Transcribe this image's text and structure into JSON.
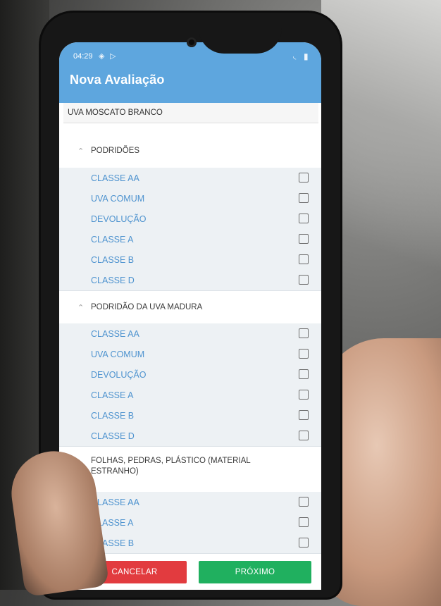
{
  "status_bar": {
    "time": "04:29",
    "left_icons": [
      "notification-icon",
      "play-store-icon"
    ],
    "right_icons": [
      "wifi-icon",
      "battery-icon"
    ]
  },
  "app_bar": {
    "title": "Nova Avaliação"
  },
  "variety": "UVA MOSCATO BRANCO",
  "colors": {
    "primary": "#5ea6de",
    "row_text": "#4e93cf",
    "cancel": "#e23b3f",
    "next": "#20b05f"
  },
  "groups": [
    {
      "title": "PODRIDÕES",
      "items": [
        "CLASSE AA",
        "UVA COMUM",
        "DEVOLUÇÃO",
        "CLASSE A",
        "CLASSE B",
        "CLASSE D"
      ]
    },
    {
      "title": "PODRIDÃO DA UVA MADURA",
      "items": [
        "CLASSE AA",
        "UVA COMUM",
        "DEVOLUÇÃO",
        "CLASSE A",
        "CLASSE B",
        "CLASSE D"
      ]
    },
    {
      "title_line1": "FOLHAS, PEDRAS, PLÁSTICO (MATERIAL",
      "title_line2": "ESTRANHO)",
      "items": [
        "CLASSE AA",
        "CLASSE A",
        "CLASSE B"
      ]
    }
  ],
  "buttons": {
    "cancel": "CANCELAR",
    "next": "PRÓXIMO"
  }
}
